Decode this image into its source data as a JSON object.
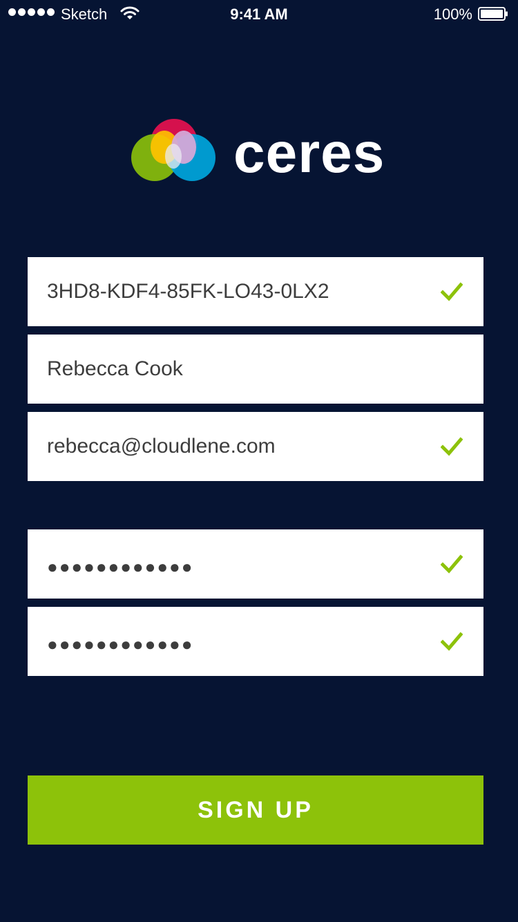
{
  "status_bar": {
    "carrier": "Sketch",
    "time": "9:41 AM",
    "battery_percent": "100%",
    "signal_icon": "signal-dots-icon",
    "wifi_icon": "wifi-icon",
    "battery_icon": "battery-icon"
  },
  "brand": {
    "wordmark": "ceres",
    "logo_icon": "ceres-overlapping-circles-logo",
    "colors": {
      "red": "#e0114f",
      "yellow": "#ffc300",
      "green": "#8dc20a",
      "blue": "#00a9e0",
      "purple": "#d3a8d7"
    }
  },
  "form": {
    "license_key": {
      "value": "3HD8-KDF4-85FK-LO43-0LX2",
      "valid": true
    },
    "full_name": {
      "value": "Rebecca Cook",
      "valid": false
    },
    "email": {
      "value": "rebecca@cloudlene.com",
      "valid": true
    },
    "password": {
      "value": "●●●●●●●●●●●●",
      "valid": true
    },
    "password_confirm": {
      "value": "●●●●●●●●●●●●",
      "valid": true
    },
    "check_icon": "checkmark-icon"
  },
  "actions": {
    "signup_label": "SIGN UP"
  },
  "theme": {
    "background": "#061433",
    "field_background": "#ffffff",
    "field_text": "#3d3d3d",
    "accent_green": "#8dc20a"
  }
}
